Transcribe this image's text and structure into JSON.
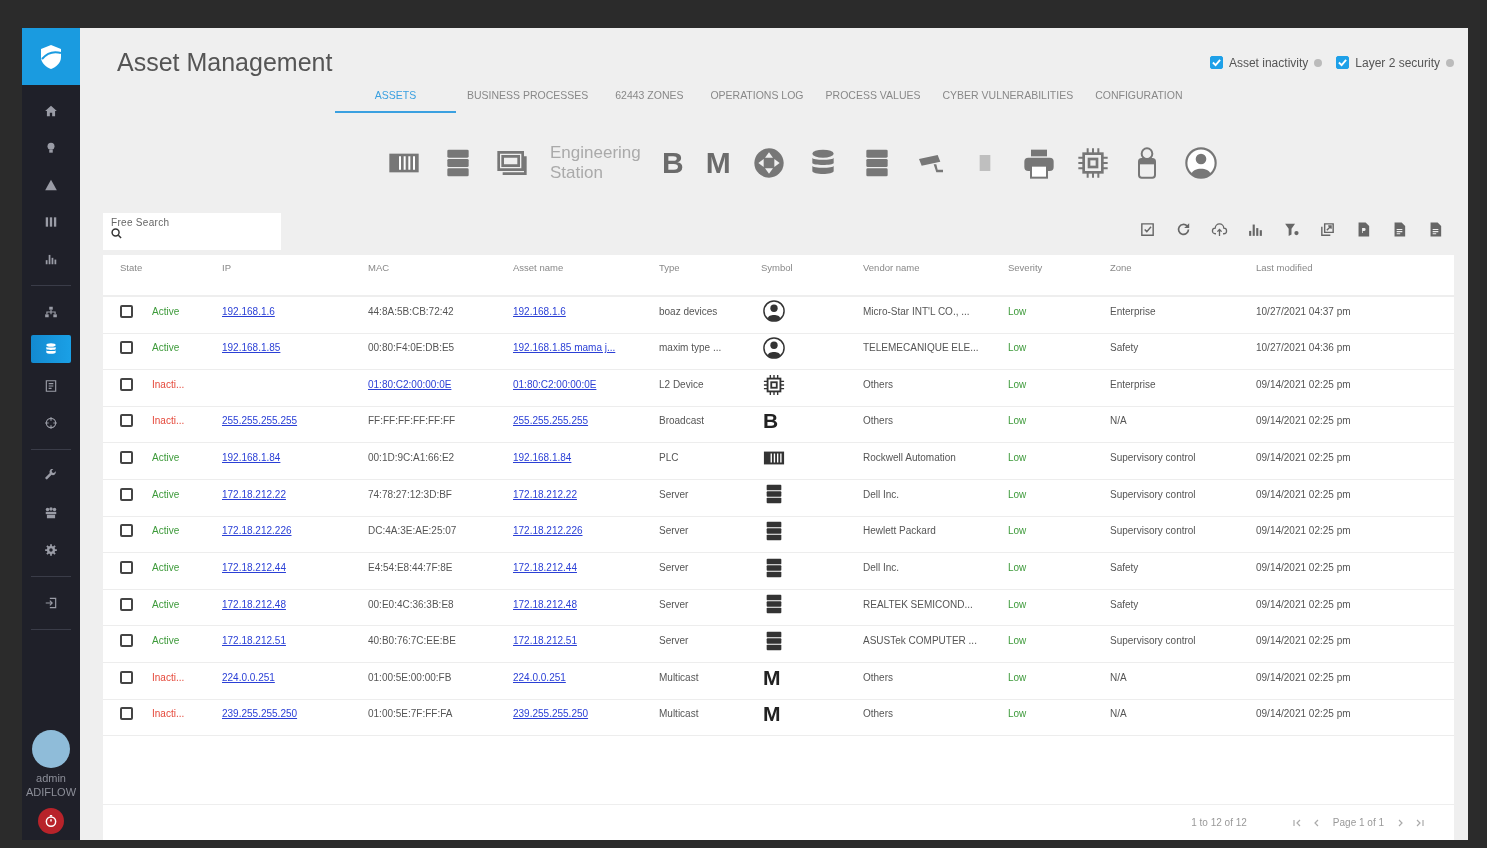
{
  "sidebar": {
    "groups": [
      [
        {
          "kind": "home",
          "selected": false
        },
        {
          "kind": "bulb",
          "selected": false
        },
        {
          "kind": "warning",
          "selected": false
        },
        {
          "kind": "columns",
          "selected": false
        },
        {
          "kind": "chart",
          "selected": false
        }
      ],
      [
        {
          "kind": "network",
          "selected": false
        },
        {
          "kind": "database",
          "selected": true
        },
        {
          "kind": "document",
          "selected": false
        },
        {
          "kind": "crosshair",
          "selected": false
        }
      ],
      [
        {
          "kind": "wrench",
          "selected": false
        },
        {
          "kind": "people",
          "selected": false
        },
        {
          "kind": "gear",
          "selected": false
        }
      ],
      [
        {
          "kind": "login",
          "selected": false
        }
      ]
    ],
    "user": {
      "name": "admin",
      "org": "ADIFLOW"
    }
  },
  "header": {
    "title": "Asset Management",
    "toggles": [
      {
        "label": "Asset inactivity",
        "checked": true
      },
      {
        "label": "Layer 2 security",
        "checked": true
      }
    ]
  },
  "tabs": [
    {
      "label": "ASSETS",
      "selected": true
    },
    {
      "label": "BUSINESS PROCESSES",
      "selected": false
    },
    {
      "label": "62443 ZONES",
      "selected": false
    },
    {
      "label": "OPERATIONS LOG",
      "selected": false
    },
    {
      "label": "PROCESS VALUES",
      "selected": false
    },
    {
      "label": "CYBER VULNERABILITIES",
      "selected": false
    },
    {
      "label": "CONFIGURATION",
      "selected": false
    }
  ],
  "type_filters": [
    {
      "kind": "plc"
    },
    {
      "kind": "server"
    },
    {
      "kind": "hmi"
    },
    {
      "kind": "broken-image",
      "label": "Engineering Station"
    },
    {
      "kind": "letter",
      "glyph": "B"
    },
    {
      "kind": "letter",
      "glyph": "M"
    },
    {
      "kind": "router"
    },
    {
      "kind": "database"
    },
    {
      "kind": "server"
    },
    {
      "kind": "camera"
    },
    {
      "kind": "iot"
    },
    {
      "kind": "printer"
    },
    {
      "kind": "chip"
    },
    {
      "kind": "tester"
    },
    {
      "kind": "user"
    }
  ],
  "search": {
    "label": "Free Search"
  },
  "toolbar": [
    {
      "kind": "select-all"
    },
    {
      "kind": "refresh"
    },
    {
      "kind": "upload"
    },
    {
      "kind": "chart"
    },
    {
      "kind": "filter"
    },
    {
      "kind": "export"
    },
    {
      "kind": "pdf"
    },
    {
      "kind": "doc"
    },
    {
      "kind": "doc"
    }
  ],
  "table": {
    "columns": [
      "State",
      "IP",
      "MAC",
      "Asset name",
      "Type",
      "Symbol",
      "Vendor name",
      "Severity",
      "Zone",
      "Last modified"
    ],
    "rows": [
      {
        "checked": false,
        "state": "Active",
        "kind": "active",
        "ip": "192.168.1.6",
        "mac": "44:8A:5B:CB:72:42",
        "mac_link": false,
        "asset": "192.168.1.6",
        "type": "boaz devices",
        "symbol": {
          "kind": "user"
        },
        "vendor": "Micro-Star INT'L CO., ...",
        "severity": "Low",
        "zone": "Enterprise",
        "modified": "10/27/2021 04:37 pm"
      },
      {
        "checked": false,
        "state": "Active",
        "kind": "active",
        "ip": "192.168.1.85",
        "mac": "00:80:F4:0E:DB:E5",
        "mac_link": false,
        "asset": "192.168.1.85 mama j...",
        "type": "maxim type ...",
        "symbol": {
          "kind": "user"
        },
        "vendor": "TELEMECANIQUE ELE...",
        "severity": "Low",
        "zone": "Safety",
        "modified": "10/27/2021 04:36 pm"
      },
      {
        "checked": false,
        "state": "Inacti...",
        "kind": "inactive",
        "mac": "01:80:C2:00:00:0E",
        "mac_link": true,
        "asset": "01:80:C2:00:00:0E",
        "type": "L2 Device",
        "symbol": {
          "kind": "chip"
        },
        "vendor": "Others",
        "severity": "Low",
        "zone": "Enterprise",
        "modified": "09/14/2021 02:25 pm"
      },
      {
        "checked": false,
        "state": "Inacti...",
        "kind": "inactive",
        "ip": "255.255.255.255",
        "mac": "FF:FF:FF:FF:FF:FF",
        "mac_link": false,
        "asset": "255.255.255.255",
        "type": "Broadcast",
        "symbol": {
          "kind": "letter",
          "glyph": "B"
        },
        "vendor": "Others",
        "severity": "Low",
        "zone": "N/A",
        "modified": "09/14/2021 02:25 pm"
      },
      {
        "checked": false,
        "state": "Active",
        "kind": "active",
        "ip": "192.168.1.84",
        "mac": "00:1D:9C:A1:66:E2",
        "mac_link": false,
        "asset": "192.168.1.84",
        "type": "PLC",
        "symbol": {
          "kind": "plc"
        },
        "vendor": "Rockwell Automation",
        "severity": "Low",
        "zone": "Supervisory control",
        "modified": "09/14/2021 02:25 pm"
      },
      {
        "checked": false,
        "state": "Active",
        "kind": "active",
        "ip": "172.18.212.22",
        "mac": "74:78:27:12:3D:BF",
        "mac_link": false,
        "asset": "172.18.212.22",
        "type": "Server",
        "symbol": {
          "kind": "server"
        },
        "vendor": "Dell Inc.",
        "severity": "Low",
        "zone": "Supervisory control",
        "modified": "09/14/2021 02:25 pm"
      },
      {
        "checked": false,
        "state": "Active",
        "kind": "active",
        "ip": "172.18.212.226",
        "mac": "DC:4A:3E:AE:25:07",
        "mac_link": false,
        "asset": "172.18.212.226",
        "type": "Server",
        "symbol": {
          "kind": "server"
        },
        "vendor": "Hewlett Packard",
        "severity": "Low",
        "zone": "Supervisory control",
        "modified": "09/14/2021 02:25 pm"
      },
      {
        "checked": false,
        "state": "Active",
        "kind": "active",
        "ip": "172.18.212.44",
        "mac": "E4:54:E8:44:7F:8E",
        "mac_link": false,
        "asset": "172.18.212.44",
        "type": "Server",
        "symbol": {
          "kind": "server"
        },
        "vendor": "Dell Inc.",
        "severity": "Low",
        "zone": "Safety",
        "modified": "09/14/2021 02:25 pm"
      },
      {
        "checked": false,
        "state": "Active",
        "kind": "active",
        "ip": "172.18.212.48",
        "mac": "00:E0:4C:36:3B:E8",
        "mac_link": false,
        "asset": "172.18.212.48",
        "type": "Server",
        "symbol": {
          "kind": "server"
        },
        "vendor": "REALTEK SEMICOND...",
        "severity": "Low",
        "zone": "Safety",
        "modified": "09/14/2021 02:25 pm"
      },
      {
        "checked": false,
        "state": "Active",
        "kind": "active",
        "ip": "172.18.212.51",
        "mac": "40:B0:76:7C:EE:BE",
        "mac_link": false,
        "asset": "172.18.212.51",
        "type": "Server",
        "symbol": {
          "kind": "server"
        },
        "vendor": "ASUSTek COMPUTER ...",
        "severity": "Low",
        "zone": "Supervisory control",
        "modified": "09/14/2021 02:25 pm"
      },
      {
        "checked": false,
        "state": "Inacti...",
        "kind": "inactive",
        "ip": "224.0.0.251",
        "mac": "01:00:5E:00:00:FB",
        "mac_link": false,
        "asset": "224.0.0.251",
        "type": "Multicast",
        "symbol": {
          "kind": "letter",
          "glyph": "M"
        },
        "vendor": "Others",
        "severity": "Low",
        "zone": "N/A",
        "modified": "09/14/2021 02:25 pm"
      },
      {
        "checked": false,
        "state": "Inacti...",
        "kind": "inactive",
        "ip": "239.255.255.250",
        "mac": "01:00:5E:7F:FF:FA",
        "mac_link": false,
        "asset": "239.255.255.250",
        "type": "Multicast",
        "symbol": {
          "kind": "letter",
          "glyph": "M"
        },
        "vendor": "Others",
        "severity": "Low",
        "zone": "N/A",
        "modified": "09/14/2021 02:25 pm"
      }
    ]
  },
  "pagination": {
    "range": "1 to 12 of 12",
    "page": "Page 1 of 1"
  }
}
